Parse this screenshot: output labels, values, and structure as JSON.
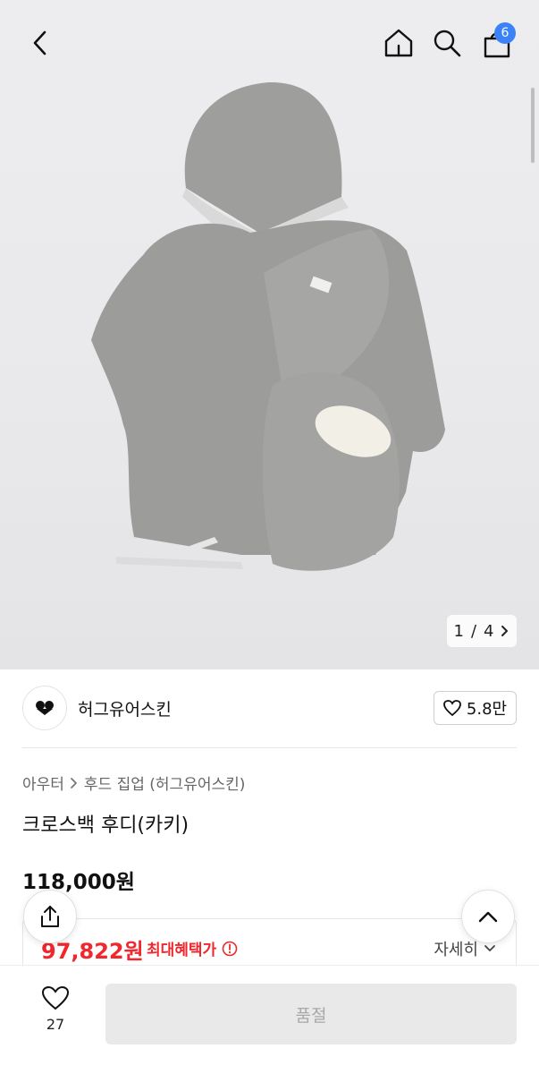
{
  "header": {
    "icons": [
      "back-icon",
      "home-icon",
      "search-icon",
      "cart-icon"
    ],
    "cart_badge": "6"
  },
  "gallery": {
    "current": "1",
    "separator": "/",
    "total": "4"
  },
  "seller": {
    "name": "허그유어스킨",
    "likes": "5.8만"
  },
  "breadcrumb": {
    "category": "아우터",
    "subcategory": "후드 집업 (허그유어스킨)"
  },
  "product": {
    "title": "크로스백 후디(카키)",
    "price": "118,000원"
  },
  "benefit": {
    "price": "97,822원",
    "label": "최대혜택가",
    "detail": "자세히"
  },
  "bottom": {
    "wish_count": "27",
    "action_label": "품절"
  },
  "colors": {
    "accent_red": "#f0282d",
    "badge_blue": "#3b82f6",
    "soldout_bg": "#e9e9ea"
  }
}
